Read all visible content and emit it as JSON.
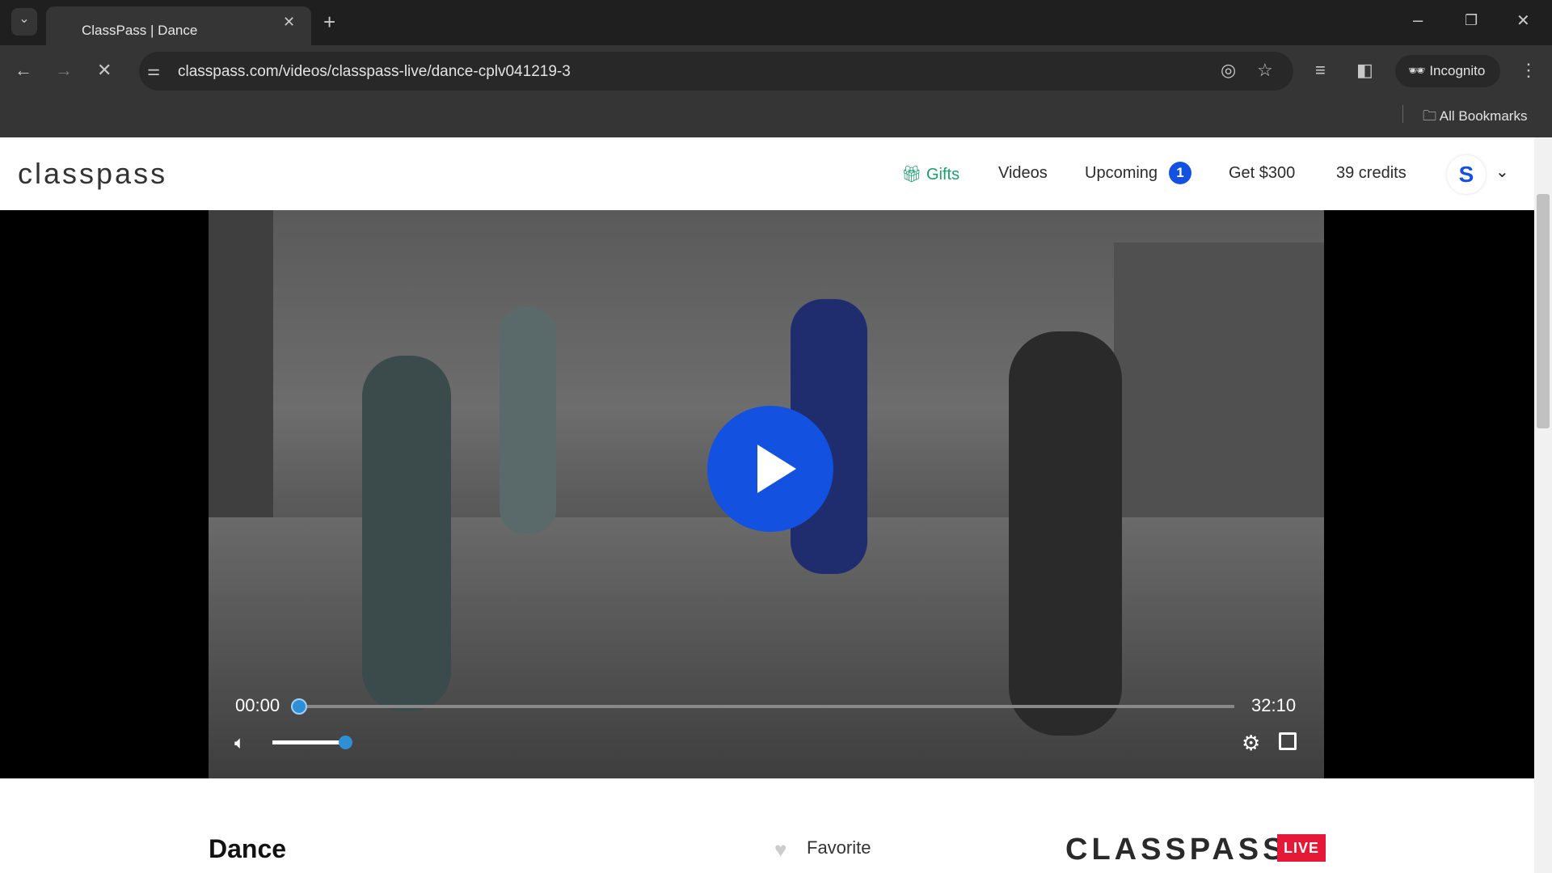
{
  "browser": {
    "tab_title": "ClassPass | Dance",
    "url": "classpass.com/videos/classpass-live/dance-cplv041219-3",
    "incognito_label": "Incognito",
    "bookmarks_label": "All Bookmarks"
  },
  "header": {
    "logo": "classpass",
    "nav": {
      "gifts": "Gifts",
      "videos": "Videos",
      "upcoming": "Upcoming",
      "upcoming_count": "1",
      "referral": "Get $300",
      "credits": "39 credits"
    },
    "avatar_initial": "S"
  },
  "player": {
    "current_time": "00:00",
    "duration": "32:10",
    "progress": 0,
    "volume": 0.9,
    "state": "paused"
  },
  "class": {
    "title": "Dance",
    "favorite_label": "Favorite",
    "brand_logo": "CLASSPASS",
    "brand_badge": "LIVE"
  },
  "colors": {
    "accent": "#1351e0",
    "gifts": "#1a9e6e",
    "live": "#e51937"
  }
}
